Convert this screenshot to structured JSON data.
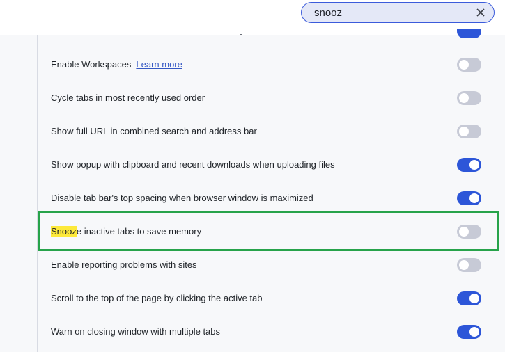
{
  "search": {
    "value": "snooz",
    "clear_glyph": "✕"
  },
  "settings": [
    {
      "label": "Enable Workspaces",
      "link": "Learn more",
      "enabled": false
    },
    {
      "label": "Cycle tabs in most recently used order",
      "enabled": false
    },
    {
      "label": "Show full URL in combined search and address bar",
      "enabled": false
    },
    {
      "label": "Show popup with clipboard and recent downloads when uploading files",
      "enabled": true
    },
    {
      "label": "Disable tab bar's top spacing when browser window is maximized",
      "enabled": true
    },
    {
      "label_highlight": "Snooz",
      "label_rest": "e inactive tabs to save memory",
      "enabled": false
    },
    {
      "label": "Enable reporting problems with sites",
      "enabled": false
    },
    {
      "label": "Scroll to the top of the page by clicking the active tab",
      "enabled": true
    },
    {
      "label": "Warn on closing window with multiple tabs",
      "enabled": true
    }
  ],
  "colors": {
    "toggle_on": "#2d56d8",
    "toggle_off": "#c7cad6",
    "highlight_border": "#27a34a",
    "search_highlight": "#fde93a"
  }
}
